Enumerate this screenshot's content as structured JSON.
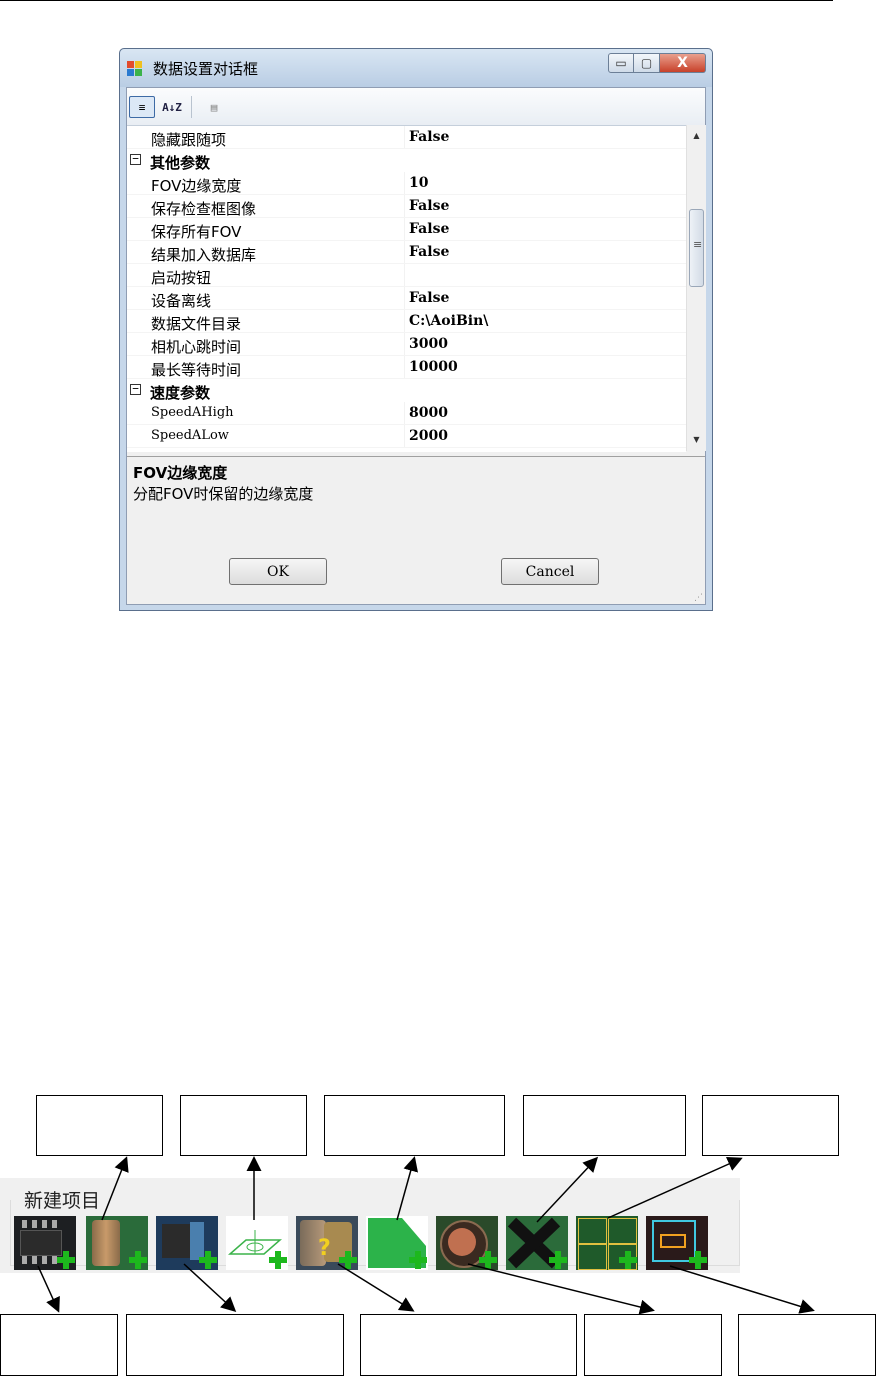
{
  "dialog": {
    "title": "数据设置对话框",
    "window_buttons": {
      "minimize": "▭",
      "maximize": "▢",
      "close": "X"
    },
    "toolbar": {
      "categorized": "≡",
      "alphabetical": "A↓Z",
      "property_pages": "▤"
    },
    "rows": [
      {
        "type": "prop",
        "name": "隐藏跟随项",
        "value": "False"
      },
      {
        "type": "cat",
        "toggle": "⊟",
        "name": "其他参数"
      },
      {
        "type": "prop",
        "name": "FOV边缘宽度",
        "value": "10"
      },
      {
        "type": "prop",
        "name": "保存检查框图像",
        "value": "False"
      },
      {
        "type": "prop",
        "name": "保存所有FOV",
        "value": "False"
      },
      {
        "type": "prop",
        "name": "结果加入数据库",
        "value": "False"
      },
      {
        "type": "prop",
        "name": "启动按钮",
        "value": ""
      },
      {
        "type": "prop",
        "name": "设备离线",
        "value": "False"
      },
      {
        "type": "prop",
        "name": "数据文件目录",
        "value": "C:\\AoiBin\\"
      },
      {
        "type": "prop",
        "name": "相机心跳时间",
        "value": "3000"
      },
      {
        "type": "prop",
        "name": "最长等待时间",
        "value": "10000"
      },
      {
        "type": "cat",
        "toggle": "⊟",
        "name": "速度参数"
      },
      {
        "type": "prop",
        "name": "SpeedAHigh",
        "value": "8000"
      },
      {
        "type": "prop",
        "name": "SpeedALow",
        "value": "2000"
      }
    ],
    "scroll": {
      "up": "▲",
      "down": "▼"
    },
    "help": {
      "title": "FOV边缘宽度",
      "description": "分配FOV时保留的边缘宽度"
    },
    "buttons": {
      "ok": "OK",
      "cancel": "Cancel"
    }
  },
  "toolbar_figure": {
    "title": "新建项目",
    "icons": [
      "ic-chip-icon",
      "capacitor-icon",
      "chip-component-icon",
      "mark-point-icon",
      "unknown-component-icon",
      "polygon-area-icon",
      "circle-pad-icon",
      "cross-mark-icon",
      "board-array-icon",
      "frame-component-icon"
    ],
    "label_boxes_top": 5,
    "label_boxes_bottom": 5
  }
}
